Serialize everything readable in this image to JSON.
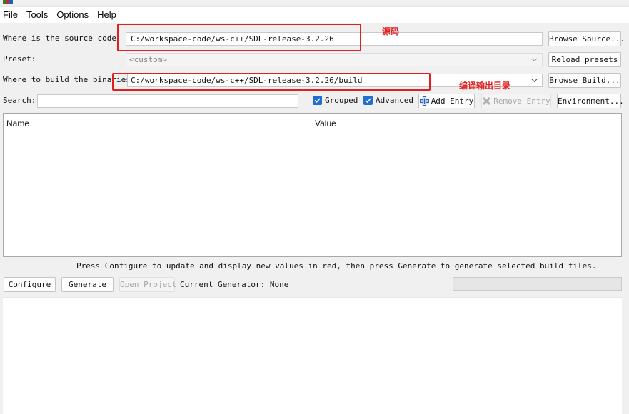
{
  "menu": {
    "items": [
      "File",
      "Tools",
      "Options",
      "Help"
    ]
  },
  "source": {
    "label": "Where is the source code:",
    "value": "C:/workspace-code/ws-c++/SDL-release-3.2.26",
    "browse_label": "Browse Source..."
  },
  "preset": {
    "label": "Preset:",
    "value": "<custom>",
    "reload_label": "Reload presets"
  },
  "build": {
    "label": "Where to build the binaries:",
    "value": "C:/workspace-code/ws-c++/SDL-release-3.2.26/build",
    "browse_label": "Browse Build..."
  },
  "search": {
    "label": "Search:",
    "value": ""
  },
  "options": {
    "grouped_label": "Grouped",
    "grouped_checked": true,
    "advanced_label": "Advanced",
    "advanced_checked": true,
    "add_entry_label": "Add Entry",
    "remove_entry_label": "Remove Entry",
    "environment_label": "Environment..."
  },
  "table": {
    "columns": [
      "Name",
      "Value"
    ],
    "rows": []
  },
  "hint": "Press Configure to update and display new values in red, then press Generate to generate selected build files.",
  "actions": {
    "configure_label": "Configure",
    "generate_label": "Generate",
    "open_project_label": "Open Project",
    "generator_text": "Current Generator: None"
  },
  "annotations": {
    "source_note": "源码",
    "build_note": "编译输出目录",
    "color": "#e02020"
  },
  "colors": {
    "accent": "#1f6fd0",
    "add_icon": "#2a5fb8"
  }
}
